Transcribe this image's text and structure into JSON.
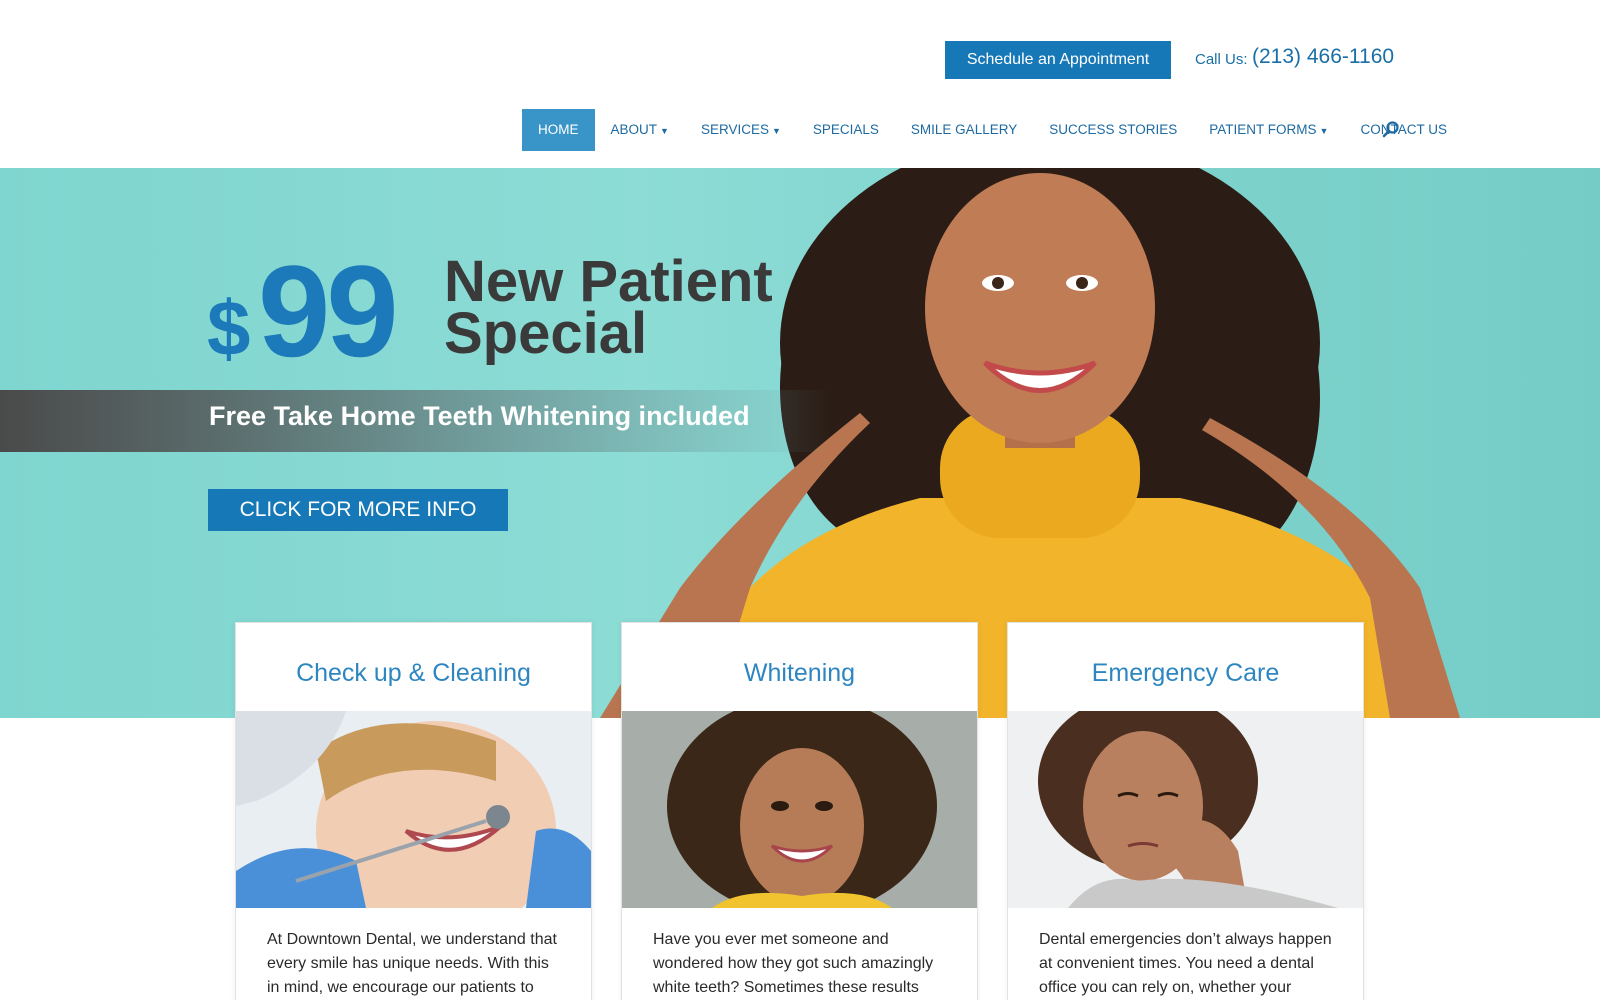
{
  "header": {
    "cta_label": "Schedule an Appointment",
    "call_label": "Call Us:",
    "phone": "(213) 466-1160"
  },
  "nav": {
    "items": [
      {
        "label": "HOME",
        "active": true,
        "dropdown": false
      },
      {
        "label": "ABOUT",
        "active": false,
        "dropdown": true
      },
      {
        "label": "SERVICES",
        "active": false,
        "dropdown": true
      },
      {
        "label": "SPECIALS",
        "active": false,
        "dropdown": false
      },
      {
        "label": "SMILE GALLERY",
        "active": false,
        "dropdown": false
      },
      {
        "label": "SUCCESS STORIES",
        "active": false,
        "dropdown": false
      },
      {
        "label": "PATIENT FORMS",
        "active": false,
        "dropdown": true
      },
      {
        "label": "CONTACT US",
        "active": false,
        "dropdown": false
      }
    ],
    "search_icon": "search-icon"
  },
  "hero": {
    "dollar": "$",
    "price": "99",
    "title_line1": "New Patient",
    "title_line2": "Special",
    "stripe_text": "Free Take Home Teeth Whitening included",
    "button_label": "CLICK FOR MORE INFO"
  },
  "cards": [
    {
      "title": "Check up & Cleaning",
      "text": "At Downtown Dental, we understand that every smile has unique needs. With this in mind, we encourage our patients to talk"
    },
    {
      "title": "Whitening",
      "text": "Have you ever met someone and wondered how they got such amazingly white teeth? Sometimes these results come"
    },
    {
      "title": "Emergency Care",
      "text": "Dental emergencies don’t always happen at convenient times. You need a dental office you can rely on, whether your"
    }
  ],
  "colors": {
    "brand_blue": "#1778b7",
    "nav_active": "#3994c8",
    "hero_teal": "#8ddcd6",
    "title_dark": "#3a3a3a"
  }
}
